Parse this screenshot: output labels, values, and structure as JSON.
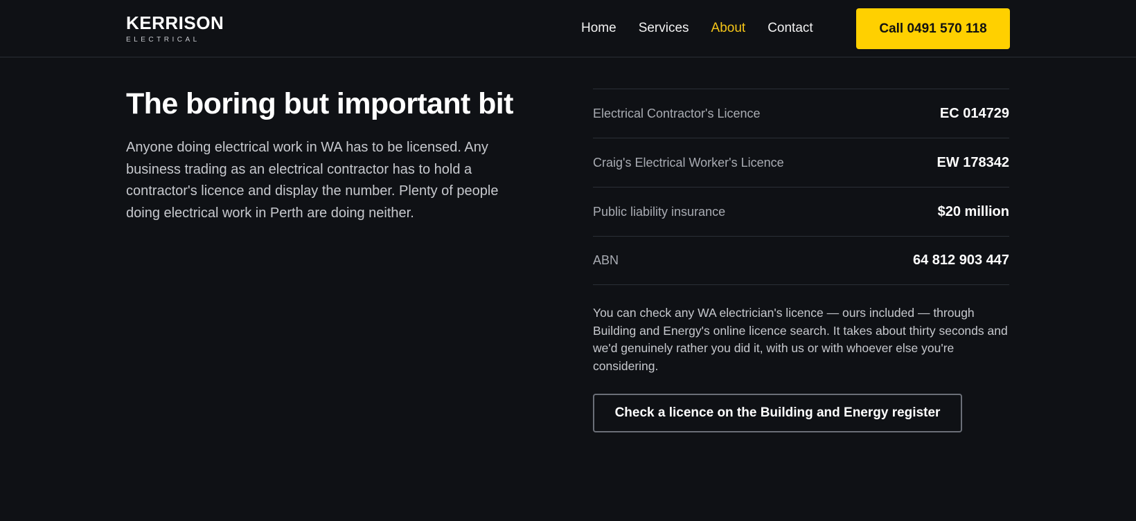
{
  "header": {
    "logo_main": "KERRISON",
    "logo_sub": "ELECTRICAL",
    "nav": [
      {
        "label": "Home"
      },
      {
        "label": "Services"
      },
      {
        "label": "About"
      },
      {
        "label": "Contact"
      }
    ],
    "active_nav": "About",
    "call_button": "Call 0491 570 118"
  },
  "main": {
    "headline": "The boring but important bit",
    "intro": "Anyone doing electrical work in WA has to be licensed. Any business trading as an electrical contractor has to hold a contractor's licence and display the number. Plenty of people doing electrical work in Perth are doing neither.",
    "details": [
      {
        "label": "Electrical Contractor's Licence",
        "value": "EC 014729"
      },
      {
        "label": "Craig's Electrical Worker's Licence",
        "value": "EW 178342"
      },
      {
        "label": "Public liability insurance",
        "value": "$20 million"
      },
      {
        "label": "ABN",
        "value": "64 812 903 447"
      }
    ],
    "note": "You can check any WA electrician's licence — ours included — through Building and Energy's online licence search. It takes about thirty seconds and we'd genuinely rather you did it, with us or with whoever else you're considering.",
    "check_button": "Check a licence on the Building and Energy register"
  },
  "colors": {
    "background": "#0f1115",
    "accent": "#ffd000",
    "active_nav": "#f5c518"
  }
}
